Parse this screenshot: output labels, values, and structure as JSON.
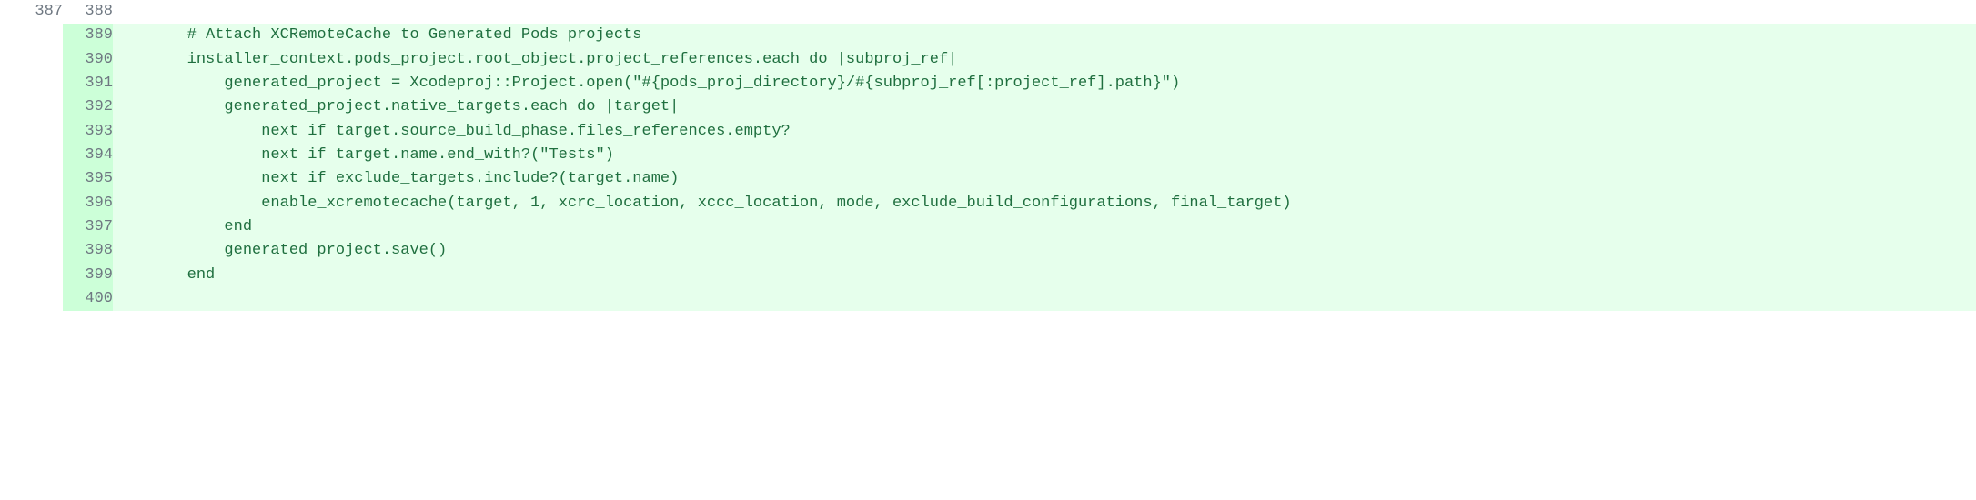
{
  "diff": {
    "rows": [
      {
        "old": "387",
        "new": "388",
        "type": "ctx",
        "code": ""
      },
      {
        "old": "",
        "new": "389",
        "type": "add",
        "code": "        # Attach XCRemoteCache to Generated Pods projects"
      },
      {
        "old": "",
        "new": "390",
        "type": "add",
        "code": "        installer_context.pods_project.root_object.project_references.each do |subproj_ref|"
      },
      {
        "old": "",
        "new": "391",
        "type": "add",
        "code": "            generated_project = Xcodeproj::Project.open(\"#{pods_proj_directory}/#{subproj_ref[:project_ref].path}\")"
      },
      {
        "old": "",
        "new": "392",
        "type": "add",
        "code": "            generated_project.native_targets.each do |target|"
      },
      {
        "old": "",
        "new": "393",
        "type": "add",
        "code": "                next if target.source_build_phase.files_references.empty?"
      },
      {
        "old": "",
        "new": "394",
        "type": "add",
        "code": "                next if target.name.end_with?(\"Tests\")"
      },
      {
        "old": "",
        "new": "395",
        "type": "add",
        "code": "                next if exclude_targets.include?(target.name)"
      },
      {
        "old": "",
        "new": "396",
        "type": "add",
        "code": "                enable_xcremotecache(target, 1, xcrc_location, xccc_location, mode, exclude_build_configurations, final_target)"
      },
      {
        "old": "",
        "new": "397",
        "type": "add",
        "code": "            end"
      },
      {
        "old": "",
        "new": "398",
        "type": "add",
        "code": "            generated_project.save()"
      },
      {
        "old": "",
        "new": "399",
        "type": "add",
        "code": "        end"
      },
      {
        "old": "",
        "new": "400",
        "type": "add",
        "code": ""
      }
    ]
  }
}
